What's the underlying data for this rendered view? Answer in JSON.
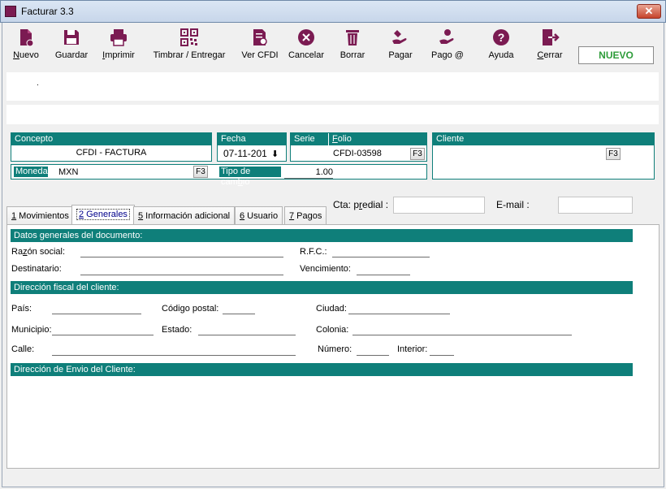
{
  "window": {
    "title": "Facturar 3.3",
    "close_glyph": "✕"
  },
  "toolbar": {
    "items": [
      {
        "label": "Nuevo",
        "icon": "new-document-icon"
      },
      {
        "label": "Guardar",
        "icon": "save-icon"
      },
      {
        "label": "Imprimir",
        "icon": "print-icon"
      },
      {
        "label": "Timbrar / Entregar",
        "icon": "qr-code-icon"
      },
      {
        "label": "Ver CFDI",
        "icon": "view-document-icon"
      },
      {
        "label": "Cancelar",
        "icon": "cancel-icon"
      },
      {
        "label": "Borrar",
        "icon": "trash-icon"
      },
      {
        "label": "Pagar",
        "icon": "pay-hand-icon"
      },
      {
        "label": "Pago @",
        "icon": "pay-online-icon"
      },
      {
        "label": "Ayuda",
        "icon": "help-icon"
      },
      {
        "label": "Cerrar",
        "icon": "exit-icon"
      }
    ],
    "status_badge": "NUEVO"
  },
  "info_band": {
    "dot": "."
  },
  "concepto": {
    "label": "Concepto",
    "value": "CFDI - FACTURA"
  },
  "fecha": {
    "label": "Fecha",
    "value": "07-11-201"
  },
  "serie": {
    "label": "Serie"
  },
  "folio": {
    "label": "Folio",
    "value": "CFDI-03598",
    "key": "F3"
  },
  "cliente": {
    "label": "Cliente",
    "value": "",
    "key": "F3"
  },
  "moneda": {
    "label": "Moneda",
    "value": "MXN",
    "key": "F3"
  },
  "tipo_cambio": {
    "label": "Tipo de cambio",
    "value": "1.00"
  },
  "cta_predial": {
    "label": "Cta: predial :",
    "value": ""
  },
  "email": {
    "label": "E-mail :",
    "value": ""
  },
  "tabs": [
    {
      "num": "1",
      "label": " Movimientos"
    },
    {
      "num": "2",
      "label": " Generales"
    },
    {
      "num": "5",
      "label": " Información adicional"
    },
    {
      "num": "6",
      "label": " Usuario"
    },
    {
      "num": "7",
      "label": " Pagos"
    }
  ],
  "sections": {
    "datos": "Datos generales del documento:",
    "direccion_fiscal": "Dirección fiscal del cliente:",
    "direccion_envio": "Dirección de Envio del Cliente:"
  },
  "fields": {
    "razon_social": "Razón social:",
    "rfc": "R.F.C.:",
    "destinatario": "Destinatario:",
    "vencimiento": "Vencimiento:",
    "pais": "País:",
    "codigo_postal": "Código postal:",
    "ciudad": "Ciudad:",
    "municipio": "Municipio:",
    "estado": "Estado:",
    "colonia": "Colonia:",
    "calle": "Calle:",
    "numero": "Número:",
    "interior": "Interior:"
  },
  "colors": {
    "accent": "#7b1b52",
    "teal": "#0f7f7a",
    "status_green": "#2e9c3a"
  }
}
